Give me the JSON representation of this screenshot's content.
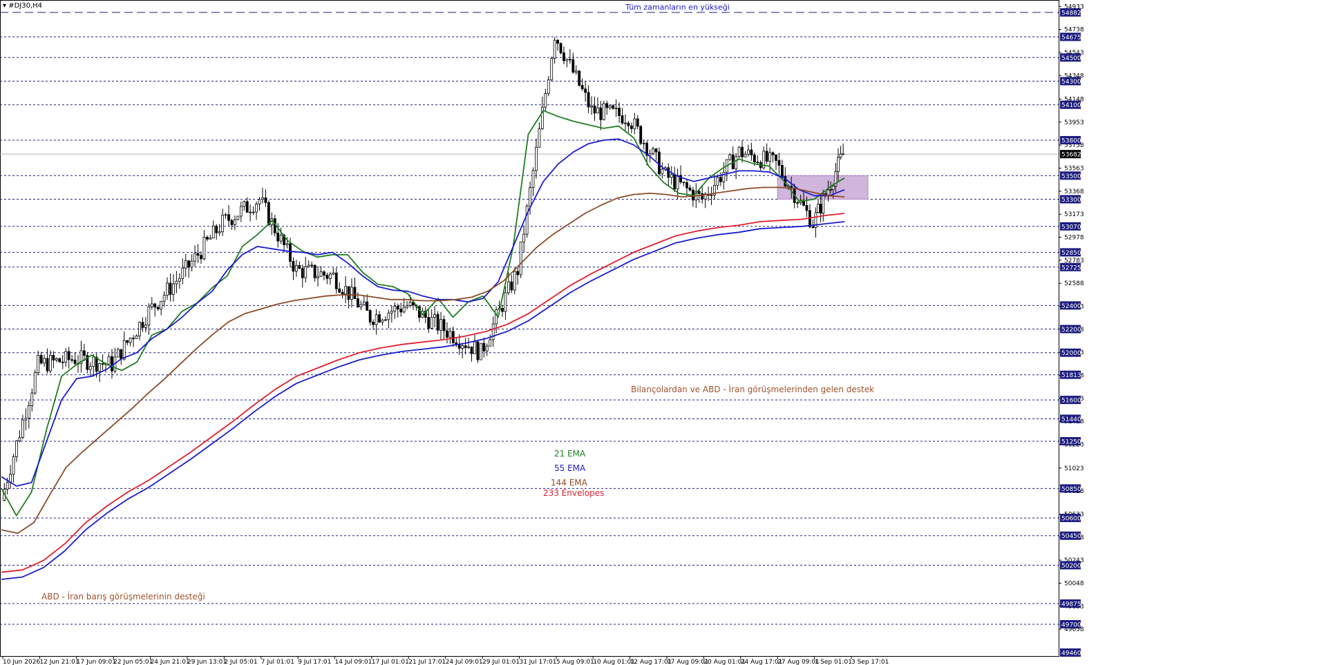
{
  "window": {
    "symbol_title": "#DJ30,H4"
  },
  "chart_data": {
    "type": "candlestick",
    "symbol": "#DJ30",
    "timeframe": "H4",
    "ylim": [
      49460,
      54990
    ],
    "x_tick_labels": [
      "10 Jun 2026",
      "12 Jun 21:01",
      "17 Jun 09:01",
      "22 Jun 05:01",
      "24 Jun 21:01",
      "29 Jun 13:01",
      "2 Jul 05:01",
      "7 Jul 01:01",
      "9 Jul 17:01",
      "14 Jul 09:01",
      "17 Jul 01:01",
      "21 Jul 17:01",
      "24 Jul 09:01",
      "29 Jul 01:01",
      "31 Jul 17:01",
      "5 Aug 09:01",
      "10 Aug 01:01",
      "12 Aug 17:01",
      "17 Aug 09:01",
      "20 Aug 01:01",
      "24 Aug 17:01",
      "27 Aug 09:01",
      "1 Sep 01:01",
      "3 Sep 17:01"
    ],
    "y_ticks_minor": [
      54933,
      54738,
      54543,
      54348,
      54148,
      53953,
      53758,
      53563,
      53368,
      53173,
      52978,
      52783,
      52588,
      52393,
      52198,
      52003,
      51808,
      51613,
      51418,
      51223,
      51023,
      50828,
      50633,
      50438,
      50243,
      50048,
      49853,
      49658
    ],
    "level_labels": [
      "54882",
      "54675",
      "54500",
      "54300",
      "54100",
      "53800",
      "53682",
      "53500",
      "53300",
      "53070",
      "52850",
      "52725",
      "52400",
      "52200",
      "52000",
      "51813",
      "51600",
      "51440",
      "51250",
      "50850",
      "50600",
      "50450",
      "50200",
      "49875",
      "49700",
      "49460"
    ],
    "horizontal_levels": [
      54882,
      54675,
      54500,
      54300,
      54100,
      53800,
      53500,
      53300,
      53070,
      52850,
      52725,
      52400,
      52200,
      52000,
      51813,
      51600,
      51440,
      51250,
      50850,
      50600,
      50450,
      50200,
      49875,
      49700
    ],
    "current_price": 53682,
    "all_time_high": 54882,
    "zone": {
      "from_x_label": "27 Aug 09:01",
      "low": 53300,
      "high": 53500
    },
    "series": [
      {
        "name": "21 EMA",
        "color": "#1e7d1e",
        "values": [
          50850,
          50620,
          50820,
          51350,
          51800,
          51900,
          51980,
          51900,
          51850,
          51920,
          52150,
          52200,
          52350,
          52420,
          52550,
          52650,
          52900,
          53000,
          53120,
          52950,
          52860,
          52810,
          52830,
          52830,
          52680,
          52580,
          52560,
          52500,
          52320,
          52460,
          52300,
          52430,
          52480,
          52300,
          52900,
          53850,
          54050,
          54000,
          53960,
          53930,
          53900,
          53920,
          53820,
          53580,
          53440,
          53350,
          53330,
          53480,
          53570,
          53640,
          53600,
          53580,
          53450,
          53280,
          53300,
          53400,
          53480
        ]
      },
      {
        "name": "55 EMA",
        "color": "#1a1acd",
        "values": [
          50950,
          50870,
          50900,
          51250,
          51600,
          51780,
          51800,
          51860,
          51950,
          52000,
          52120,
          52200,
          52300,
          52420,
          52520,
          52700,
          52830,
          52900,
          52880,
          52860,
          52850,
          52830,
          52850,
          52760,
          52650,
          52560,
          52530,
          52520,
          52480,
          52450,
          52450,
          52430,
          52460,
          52600,
          52900,
          53200,
          53450,
          53600,
          53700,
          53770,
          53800,
          53810,
          53760,
          53670,
          53560,
          53490,
          53450,
          53480,
          53510,
          53540,
          53540,
          53530,
          53480,
          53380,
          53330,
          53330,
          53380
        ]
      },
      {
        "name": "144 EMA",
        "color": "#8b4a26",
        "values": [
          50500,
          50470,
          50560,
          50800,
          51030,
          51160,
          51280,
          51400,
          51520,
          51650,
          51770,
          51900,
          52030,
          52150,
          52260,
          52330,
          52370,
          52410,
          52440,
          52460,
          52480,
          52490,
          52490,
          52470,
          52450,
          52450,
          52440,
          52440,
          52450,
          52470,
          52520,
          52610,
          52750,
          52890,
          53000,
          53090,
          53180,
          53250,
          53310,
          53340,
          53350,
          53340,
          53320,
          53330,
          53350,
          53370,
          53390,
          53400,
          53400,
          53390,
          53360,
          53330,
          53320
        ]
      },
      {
        "name": "233 Envelopes",
        "color": "#e01e2e",
        "values": [
          50140,
          50160,
          50240,
          50380,
          50560,
          50700,
          50820,
          50920,
          51040,
          51160,
          51290,
          51420,
          51560,
          51690,
          51800,
          51870,
          51940,
          52000,
          52040,
          52070,
          52090,
          52110,
          52140,
          52180,
          52240,
          52330,
          52450,
          52570,
          52670,
          52760,
          52850,
          52920,
          52990,
          53030,
          53060,
          53080,
          53110,
          53120,
          53130,
          53160,
          53180
        ]
      },
      {
        "name": "233 Envelopes",
        "color": "#1a1acd",
        "values": [
          50080,
          50100,
          50180,
          50320,
          50500,
          50640,
          50760,
          50860,
          50980,
          51100,
          51230,
          51360,
          51500,
          51630,
          51740,
          51810,
          51880,
          51940,
          51980,
          52010,
          52030,
          52050,
          52080,
          52120,
          52180,
          52270,
          52390,
          52510,
          52610,
          52700,
          52790,
          52860,
          52930,
          52970,
          53000,
          53020,
          53050,
          53060,
          53070,
          53090,
          53110
        ]
      }
    ],
    "candles": [
      {
        "x_label": "10 Jun 2026",
        "close": 50750
      },
      {
        "x_label": "12 Jun 21:01",
        "close": 51900
      },
      {
        "x_label": "17 Jun 09:01",
        "close": 51950
      },
      {
        "x_label": "22 Jun 05:01",
        "close": 51900
      },
      {
        "x_label": "24 Jun 21:01",
        "close": 52350
      },
      {
        "x_label": "29 Jun 13:01",
        "close": 52700
      },
      {
        "x_label": "2 Jul 05:01",
        "close": 53100
      },
      {
        "x_label": "7 Jul 01:01",
        "close": 53300
      },
      {
        "x_label": "9 Jul 17:01",
        "close": 52700
      },
      {
        "x_label": "14 Jul 09:01",
        "close": 52650
      },
      {
        "x_label": "17 Jul 01:01",
        "close": 52300
      },
      {
        "x_label": "21 Jul 17:01",
        "close": 52400
      },
      {
        "x_label": "24 Jul 09:01",
        "close": 52200
      },
      {
        "x_label": "29 Jul 01:01",
        "close": 52000
      },
      {
        "x_label": "31 Jul 17:01",
        "close": 52700
      },
      {
        "x_label": "5 Aug 09:01",
        "close": 54700
      },
      {
        "x_label": "10 Aug 01:01",
        "close": 54050
      },
      {
        "x_label": "12 Aug 17:01",
        "close": 54000
      },
      {
        "x_label": "17 Aug 09:01",
        "close": 53500
      },
      {
        "x_label": "20 Aug 01:01",
        "close": 53300
      },
      {
        "x_label": "24 Aug 17:01",
        "close": 53700
      },
      {
        "x_label": "27 Aug 09:01",
        "close": 53600
      },
      {
        "x_label": "1 Sep 01:01",
        "close": 53100
      },
      {
        "x_label": "3 Sep 17:01",
        "close": 53682
      }
    ]
  },
  "annotations": {
    "ath_label": "Tüm zamanların en yükseği",
    "support_earnings": "Bilançolardan ve ABD - İran görüşmelerinden gelen destek",
    "support_peace": "ABD - İran barış görüşmelerinin desteği"
  },
  "legend": {
    "ema21": "21 EMA",
    "ema55": "55 EMA",
    "ema144": "144 EMA",
    "env233": "233 Envelopes"
  },
  "colors": {
    "ema21": "#1e7d1e",
    "ema55": "#1a1acd",
    "ema144": "#8b4a26",
    "env233": "#e01e2e",
    "level_line": "#1c1c80",
    "zone_fill": "#c8a8d6",
    "annotation_text": "#a0522d",
    "ath_text": "#1a1acd",
    "price_tag_bg": "#000000"
  }
}
